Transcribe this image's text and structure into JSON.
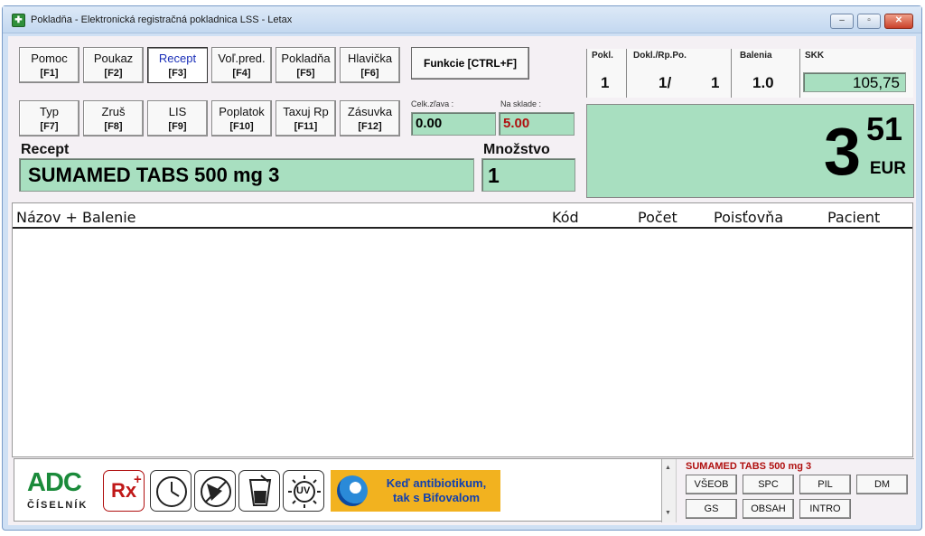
{
  "window": {
    "title": "Pokladňa - Elektronická registračná pokladnica LSS - Letax",
    "minimize": "–",
    "maximize": "▫",
    "close": "✕"
  },
  "function_keys": [
    {
      "label": "Pomoc",
      "key": "[F1]"
    },
    {
      "label": "Poukaz",
      "key": "[F2]"
    },
    {
      "label": "Recept",
      "key": "[F3]"
    },
    {
      "label": "Voľ.pred.",
      "key": "[F4]"
    },
    {
      "label": "Pokladňa",
      "key": "[F5]"
    },
    {
      "label": "Hlavička",
      "key": "[F6]"
    },
    {
      "label": "Typ",
      "key": "[F7]"
    },
    {
      "label": "Zruš",
      "key": "[F8]"
    },
    {
      "label": "LIS",
      "key": "[F9]"
    },
    {
      "label": "Poplatok",
      "key": "[F10]"
    },
    {
      "label": "Taxuj Rp",
      "key": "[F11]"
    },
    {
      "label": "Zásuvka",
      "key": "[F12]"
    }
  ],
  "active_function": "Recept",
  "functions_button": "Funkcie [CTRL+F]",
  "totals": {
    "celk_zlava_label": "Celk.zľava :",
    "celk_zlava_value": "0.00",
    "na_sklade_label": "Na sklade :",
    "na_sklade_value": "5.00"
  },
  "recept": {
    "label": "Recept",
    "value": "SUMAMED TABS 500 mg 3"
  },
  "mnozstvo": {
    "label": "Množstvo",
    "value": "1"
  },
  "info": {
    "pokl_label": "Pokl.",
    "pokl_value": "1",
    "dokl_label": "Dokl./Rp.Po.",
    "dokl_value": "1/",
    "dokl_value2": "1",
    "balenia_label": "Balenia",
    "balenia_value": "1.0",
    "skk_label": "SKK",
    "skk_value": "105,75"
  },
  "amount": {
    "integer": "3",
    "decimal": "51",
    "currency": "EUR"
  },
  "list": {
    "columns": [
      "Názov + Balenie",
      "Kód",
      "Počet",
      "Poisťovňa",
      "Pacient"
    ],
    "rows": []
  },
  "bottom": {
    "adc_main": "ADC",
    "adc_sub": "ČÍSELNÍK",
    "rx_label": "Rx",
    "rx_plus": "+",
    "uv_label": "UV",
    "banner_line1": "Keď antibiotikum,",
    "banner_line2": "tak s Bifovalom"
  },
  "drug_info": {
    "title": "SUMAMED TABS 500 mg 3",
    "buttons": [
      "VŠEOB",
      "SPC",
      "PIL",
      "DM",
      "GS",
      "OBSAH",
      "INTRO"
    ]
  },
  "colors": {
    "field_green": "#a8dfc0",
    "stock_red": "#b01010",
    "active_blue": "#1a2fb8",
    "adc_green": "#1a8a3a",
    "banner_orange": "#f2b21f"
  }
}
